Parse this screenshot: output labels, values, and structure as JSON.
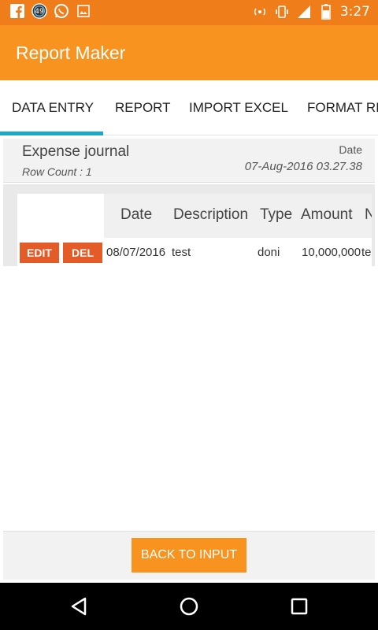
{
  "status": {
    "time": "3:27",
    "notif_badge": "49",
    "icons_left": [
      "facebook-icon",
      "notification-badge",
      "whatsapp-icon",
      "gallery-icon"
    ],
    "icons_right": [
      "wifi-icon",
      "vibrate-icon",
      "signal-icon",
      "battery-icon"
    ]
  },
  "app": {
    "title": "Report Maker"
  },
  "tabs": [
    {
      "label": "DATA ENTRY",
      "active": true
    },
    {
      "label": "REPORT",
      "active": false
    },
    {
      "label": "IMPORT EXCEL",
      "active": false
    },
    {
      "label": "FORMAT RE",
      "active": false
    }
  ],
  "journal": {
    "title": "Expense journal",
    "row_count": "Row Count : 1",
    "date_label": "Date",
    "date_value": "07-Aug-2016 03.27.38"
  },
  "table": {
    "headers": [
      "Date",
      "Description",
      "Type",
      "Amount",
      "N"
    ],
    "rows": [
      {
        "edit": "EDIT",
        "del": "DEL",
        "date": "08/07/2016",
        "description": "test",
        "type": "doni",
        "amount": "10,000,000",
        "extra": "te"
      }
    ]
  },
  "footer": {
    "back_label": "BACK TO INPUT"
  },
  "colors": {
    "primary": "#f7931e",
    "statusbar": "#ee7d1a",
    "accent": "#1aa8c9",
    "danger": "#e35b26"
  }
}
